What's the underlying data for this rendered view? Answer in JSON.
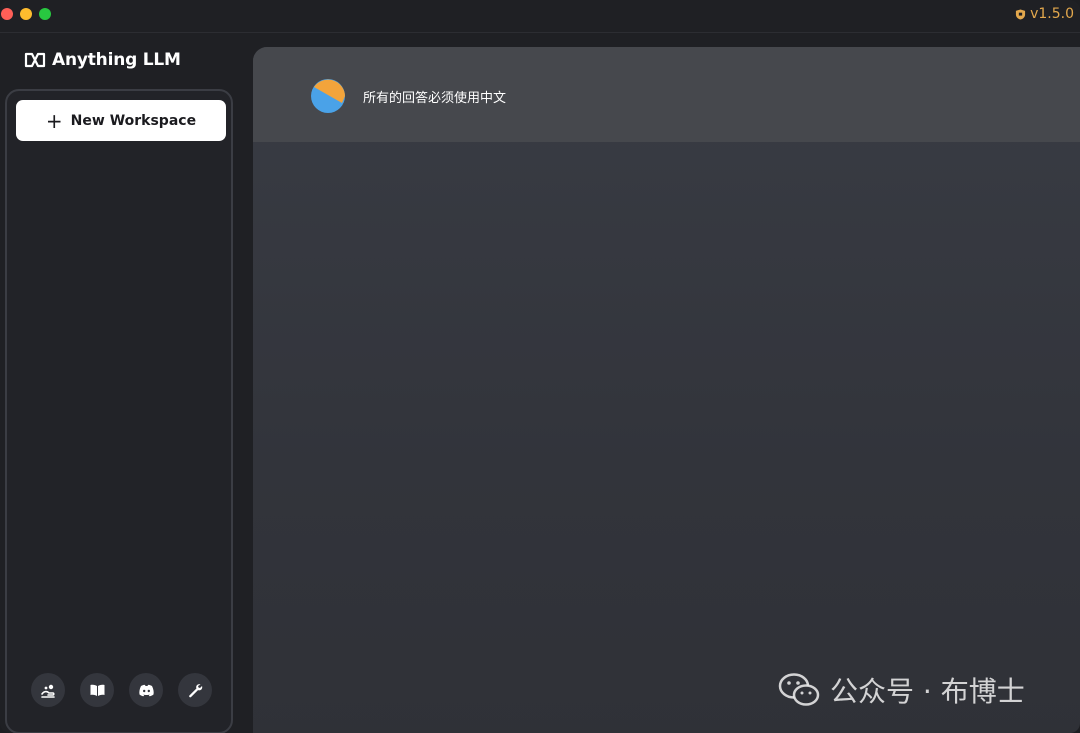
{
  "titlebar": {
    "version": "v1.5.0"
  },
  "sidebar": {
    "logo_text": "Anything LLM",
    "new_workspace_label": "New Workspace",
    "footer_icons": [
      "community-hub-icon",
      "docs-book-icon",
      "discord-icon",
      "settings-wrench-icon"
    ]
  },
  "main": {
    "workspace_title": "所有的回答必须使用中文"
  },
  "watermark": {
    "text": "公众号 · 布博士"
  },
  "colors": {
    "accent_version": "#e3a84d",
    "sidebar_bg": "#222328",
    "main_header_bg": "#46484d",
    "avatar_orange": "#f3a43b",
    "avatar_blue": "#4aa2e8"
  }
}
